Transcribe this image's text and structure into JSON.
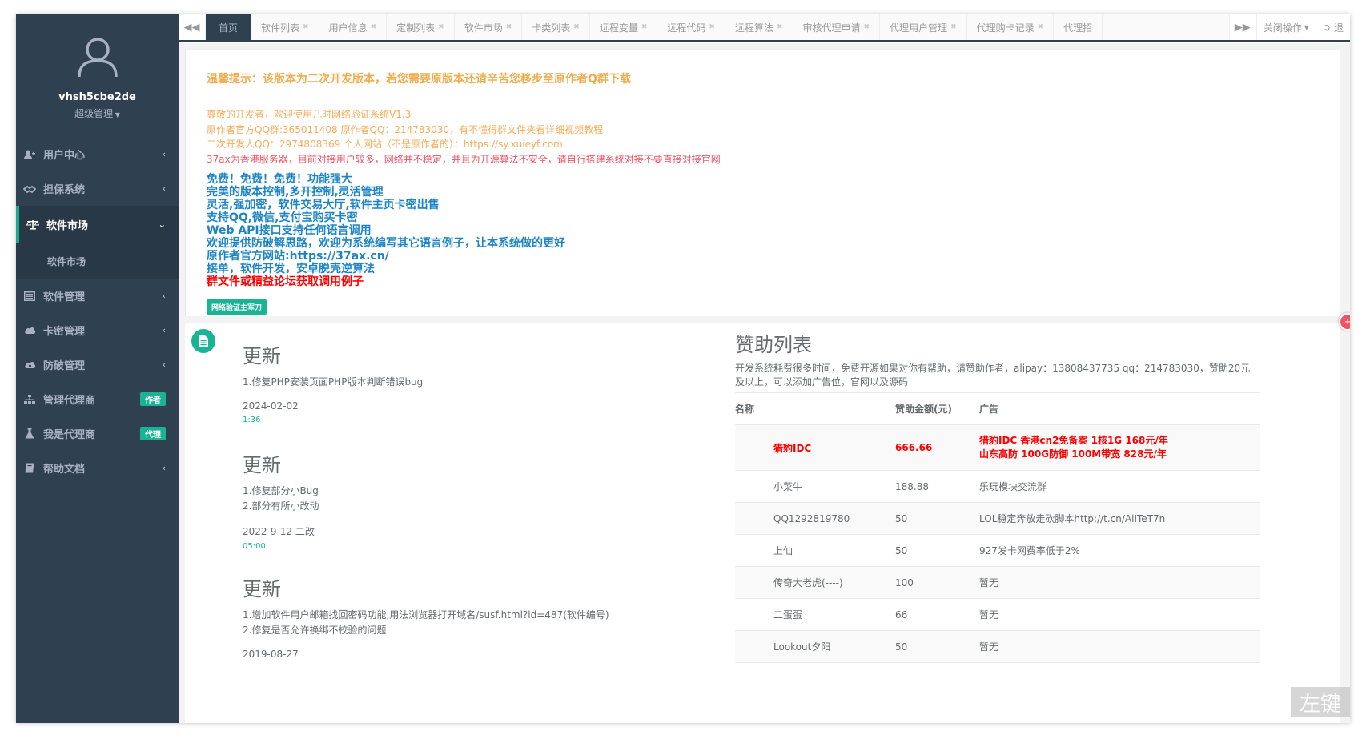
{
  "sidebar": {
    "username": "vhsh5cbe2de",
    "role": "超级管理",
    "items": [
      {
        "label": "用户中心",
        "icon": "user-icon"
      },
      {
        "label": "担保系统",
        "icon": "handshake-icon"
      },
      {
        "label": "软件市场",
        "icon": "scale-icon",
        "sub": "软件市场"
      },
      {
        "label": "软件管理",
        "icon": "list-icon"
      },
      {
        "label": "卡密管理",
        "icon": "cloud-icon"
      },
      {
        "label": "防破管理",
        "icon": "cloud-lock-icon"
      },
      {
        "label": "管理代理商",
        "icon": "sitemap-icon",
        "badge": "作者"
      },
      {
        "label": "我是代理商",
        "icon": "flask-icon",
        "badge": "代理"
      },
      {
        "label": "帮助文档",
        "icon": "book-icon"
      }
    ]
  },
  "tabs": {
    "items": [
      "首页",
      "软件列表",
      "用户信息",
      "定制列表",
      "软件市场",
      "卡类列表",
      "远程变量",
      "远程代码",
      "远程算法",
      "审核代理申请",
      "代理用户管理",
      "代理购卡记录",
      "代理招"
    ],
    "close_ops": "关闭操作",
    "exit": "退"
  },
  "notice": {
    "title": "温馨提示：该版本为二次开发版本，若您需要原版本还请辛苦您移步至原作者Q群下载",
    "lines": [
      "尊敬的开发者，欢迎使用几时网络验证系统V1.3",
      "原作者官方QQ群:365011408 原作者QQ：214783030，有不懂得群文件夹看详细视频教程",
      "二次开发人QQ：2974808369 个人网站（不是原作者的）：https://sy.xuieyf.com"
    ],
    "red_line": "37ax为香港服务器，目前对接用户较多，网络并不稳定，并且为开源算法不安全，请自行搭建系统对接不要直接对接官网",
    "features": [
      "免费！免费！免费！功能强大",
      "完美的版本控制,多开控制,灵活管理",
      "灵活,强加密，软件交易大厅,软件主页卡密出售",
      "支持QQ,微信,支付宝购买卡密",
      "Web API接口支持任何语言调用",
      "欢迎提供防破解思路，欢迎为系统编写其它语言例子，让本系统做的更好",
      "原作者官方网站:https://37ax.cn/",
      "接单，软件开发，安卓脱壳逆算法"
    ],
    "features_red": "群文件或精益论坛获取调用例子",
    "tag": "网络验证主军刀"
  },
  "timeline": [
    {
      "title": "更新",
      "lines": [
        "1.修复PHP安装页面PHP版本判断错误bug"
      ],
      "date": "2024-02-02",
      "time": "1:36"
    },
    {
      "title": "更新",
      "lines": [
        "1.修复部分小Bug",
        "2.部分有所小改动"
      ],
      "date": "2022-9-12 二改",
      "time": "05:00"
    },
    {
      "title": "更新",
      "lines": [
        "1.增加软件用户邮箱找回密码功能,用法浏览器打开域名/susf.html?id=487(软件编号)",
        "2.修复是否允许换绑不校验的问题"
      ],
      "date": "2019-08-27",
      "time": ""
    }
  ],
  "sponsor": {
    "title": "赞助列表",
    "desc": "开发系统耗费很多时间，免费开源如果对你有帮助，请赞助作者，alipay：13808437735 qq：214783030，赞助20元及以上，可以添加广告位，官网以及源码",
    "headers": [
      "名称",
      "赞助金额(元)",
      "广告"
    ],
    "rows": [
      {
        "name": "猎豹IDC",
        "amount": "666.66",
        "ad1": "猎豹IDC 香港cn2免备案 1核1G 168元/年",
        "ad2": "山东高防 100G防御 100M带宽 828元/年"
      },
      {
        "name": "小菜牛",
        "amount": "188.88",
        "ad1": "乐玩模块交流群"
      },
      {
        "name": "QQ1292819780",
        "amount": "50",
        "ad1": "LOL稳定奔放走砍脚本http://t.cn/AiITeT7n"
      },
      {
        "name": "上仙",
        "amount": "50",
        "ad1": "927发卡网费率低于2%"
      },
      {
        "name": "传奇大老虎(----)",
        "amount": "100",
        "ad1": "暂无"
      },
      {
        "name": "二蛋蛋",
        "amount": "66",
        "ad1": "暂无"
      },
      {
        "name": "Lookout夕阳",
        "amount": "50",
        "ad1": "暂无"
      }
    ]
  },
  "watermark": "左键"
}
